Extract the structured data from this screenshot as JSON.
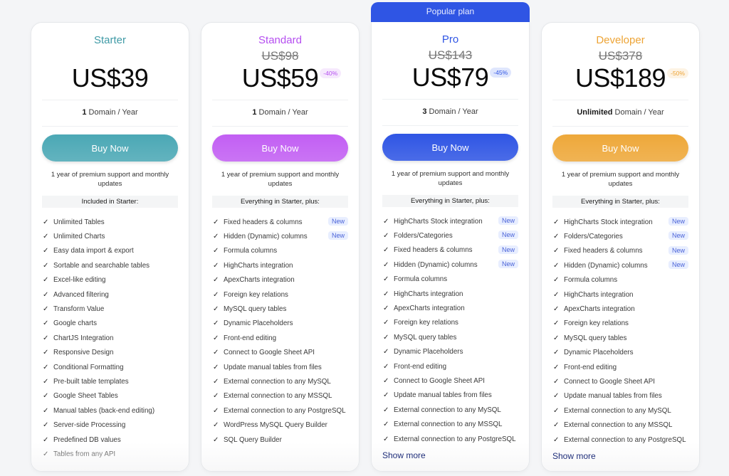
{
  "popular_banner": "Popular plan",
  "plans": [
    {
      "name": "Starter",
      "name_color": "#3f9aa6",
      "old_price": null,
      "price": "US$39",
      "discount": null,
      "domains_count": "1",
      "domains_suffix": " Domain / Year",
      "buy_label": "Buy Now",
      "button_color": "#4ba8b5",
      "support": "1 year of premium support and monthly updates",
      "included_header": "Included in Starter:",
      "features": [
        {
          "label": "Unlimited Tables",
          "new": false
        },
        {
          "label": "Unlimited Charts",
          "new": false
        },
        {
          "label": "Easy data import & export",
          "new": false
        },
        {
          "label": "Sortable and searchable tables",
          "new": false
        },
        {
          "label": "Excel-like editing",
          "new": false
        },
        {
          "label": "Advanced filtering",
          "new": false
        },
        {
          "label": "Transform Value",
          "new": false
        },
        {
          "label": "Google charts",
          "new": false
        },
        {
          "label": "ChartJS Integration",
          "new": false
        },
        {
          "label": "Responsive Design",
          "new": false
        },
        {
          "label": "Conditional Formatting",
          "new": false
        },
        {
          "label": "Pre-built table templates",
          "new": false
        },
        {
          "label": "Google Sheet Tables",
          "new": false
        },
        {
          "label": "Manual tables (back-end editing)",
          "new": false
        },
        {
          "label": "Server-side Processing",
          "new": false
        },
        {
          "label": "Predefined DB values",
          "new": false
        },
        {
          "label": "Tables from any API",
          "new": false
        }
      ],
      "show_more": null
    },
    {
      "name": "Standard",
      "name_color": "#b54ef0",
      "old_price": "US$98",
      "price": "US$59",
      "discount": "-40%",
      "discount_bg": "#f6e9fd",
      "discount_color": "#b54ef0",
      "domains_count": "1",
      "domains_suffix": " Domain / Year",
      "buy_label": "Buy Now",
      "button_color": "#c25ff3",
      "support": "1 year of premium support and monthly updates",
      "included_header": "Everything in Starter, plus:",
      "features": [
        {
          "label": "Fixed headers & columns",
          "new": true
        },
        {
          "label": "Hidden (Dynamic) columns",
          "new": true
        },
        {
          "label": "Formula columns",
          "new": false
        },
        {
          "label": "HighCharts integration",
          "new": false
        },
        {
          "label": "ApexCharts integration",
          "new": false
        },
        {
          "label": "Foreign key relations",
          "new": false
        },
        {
          "label": "MySQL query tables",
          "new": false
        },
        {
          "label": "Dynamic Placeholders",
          "new": false
        },
        {
          "label": "Front-end editing",
          "new": false
        },
        {
          "label": "Connect to Google Sheet API",
          "new": false
        },
        {
          "label": "Update manual tables from files",
          "new": false
        },
        {
          "label": "External connection to any MySQL",
          "new": false
        },
        {
          "label": "External connection to any MSSQL",
          "new": false
        },
        {
          "label": "External connection to any PostgreSQL",
          "new": false
        },
        {
          "label": "WordPress MySQL Query Builder",
          "new": false
        },
        {
          "label": "SQL Query Builder",
          "new": false
        }
      ],
      "show_more": null
    },
    {
      "name": "Pro",
      "name_color": "#2f55e4",
      "old_price": "US$143",
      "price": "US$79",
      "discount": "-45%",
      "discount_bg": "#dfe6fd",
      "discount_color": "#2f55e4",
      "domains_count": "3",
      "domains_suffix": " Domain / Year",
      "buy_label": "Buy Now",
      "button_color": "#2f55e4",
      "support": "1 year of premium support and monthly updates",
      "included_header": "Everything in Starter, plus:",
      "features": [
        {
          "label": "HighCharts Stock integration",
          "new": true
        },
        {
          "label": "Folders/Categories",
          "new": true
        },
        {
          "label": "Fixed headers & columns",
          "new": true
        },
        {
          "label": "Hidden (Dynamic) columns",
          "new": true
        },
        {
          "label": "Formula columns",
          "new": false
        },
        {
          "label": "HighCharts integration",
          "new": false
        },
        {
          "label": "ApexCharts integration",
          "new": false
        },
        {
          "label": "Foreign key relations",
          "new": false
        },
        {
          "label": "MySQL query tables",
          "new": false
        },
        {
          "label": "Dynamic Placeholders",
          "new": false
        },
        {
          "label": "Front-end editing",
          "new": false
        },
        {
          "label": "Connect to Google Sheet API",
          "new": false
        },
        {
          "label": "Update manual tables from files",
          "new": false
        },
        {
          "label": "External connection to any MySQL",
          "new": false
        },
        {
          "label": "External connection to any MSSQL",
          "new": false
        },
        {
          "label": "External connection to any PostgreSQL",
          "new": false
        }
      ],
      "show_more": "Show more"
    },
    {
      "name": "Developer",
      "name_color": "#eda436",
      "old_price": "US$378",
      "price": "US$189",
      "discount": "-50%",
      "discount_bg": "#fdf3e4",
      "discount_color": "#eda436",
      "domains_count": "Unlimited",
      "domains_suffix": " Domain / Year",
      "buy_label": "Buy Now",
      "button_color": "#eea83a",
      "support": "1 year of premium support and monthly updates",
      "included_header": "Everything in Starter, plus:",
      "features": [
        {
          "label": "HighCharts Stock integration",
          "new": true
        },
        {
          "label": "Folders/Categories",
          "new": true
        },
        {
          "label": "Fixed headers & columns",
          "new": true
        },
        {
          "label": "Hidden (Dynamic) columns",
          "new": true
        },
        {
          "label": "Formula columns",
          "new": false
        },
        {
          "label": "HighCharts integration",
          "new": false
        },
        {
          "label": "ApexCharts integration",
          "new": false
        },
        {
          "label": "Foreign key relations",
          "new": false
        },
        {
          "label": "MySQL query tables",
          "new": false
        },
        {
          "label": "Dynamic Placeholders",
          "new": false
        },
        {
          "label": "Front-end editing",
          "new": false
        },
        {
          "label": "Connect to Google Sheet API",
          "new": false
        },
        {
          "label": "Update manual tables from files",
          "new": false
        },
        {
          "label": "External connection to any MySQL",
          "new": false
        },
        {
          "label": "External connection to any MSSQL",
          "new": false
        },
        {
          "label": "External connection to any PostgreSQL",
          "new": false
        }
      ],
      "show_more": "Show more"
    }
  ],
  "new_badge_label": "New",
  "check_glyph": "✓"
}
